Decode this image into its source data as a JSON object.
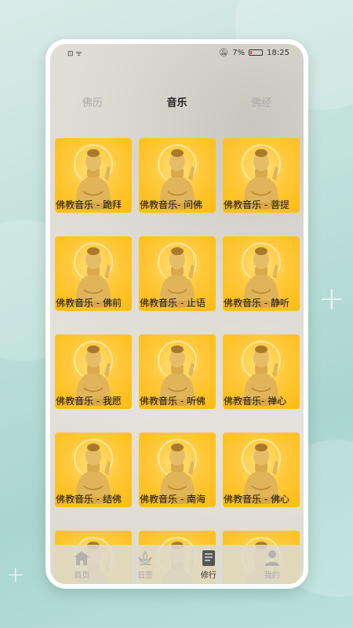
{
  "status_bar": {
    "left": "⊡ ᯤ",
    "battery_pct": "7%",
    "time": "18:25"
  },
  "tabs": [
    {
      "label": "佛历",
      "active": false
    },
    {
      "label": "音乐",
      "active": true
    },
    {
      "label": "佛经",
      "active": false
    }
  ],
  "cards": [
    {
      "label": "佛教音乐 - 跪拜"
    },
    {
      "label": "佛教音乐- 问佛"
    },
    {
      "label": "佛教音乐 - 菩提"
    },
    {
      "label": "佛教音乐 - 佛前"
    },
    {
      "label": "佛教音乐 - 止语"
    },
    {
      "label": "佛教音乐 - 静听"
    },
    {
      "label": "佛教音乐 - 我愿"
    },
    {
      "label": "佛教音乐 - 听佛"
    },
    {
      "label": "佛教音乐- 禅心"
    },
    {
      "label": "佛教音乐 - 结佛"
    },
    {
      "label": "佛教音乐 - 南海"
    },
    {
      "label": "佛教音乐 - 佛心"
    },
    {
      "label": ""
    },
    {
      "label": ""
    },
    {
      "label": ""
    }
  ],
  "bottom_nav": [
    {
      "label": "首页",
      "icon": "home-icon",
      "active": false
    },
    {
      "label": "日签",
      "icon": "lotus-hands-icon",
      "active": false
    },
    {
      "label": "修行",
      "icon": "book-icon",
      "active": true
    },
    {
      "label": "我的",
      "icon": "user-icon",
      "active": false
    }
  ],
  "colors": {
    "card_gold": "#ffbb10",
    "active_text": "#222222",
    "inactive_text": "#aaaaaa"
  }
}
